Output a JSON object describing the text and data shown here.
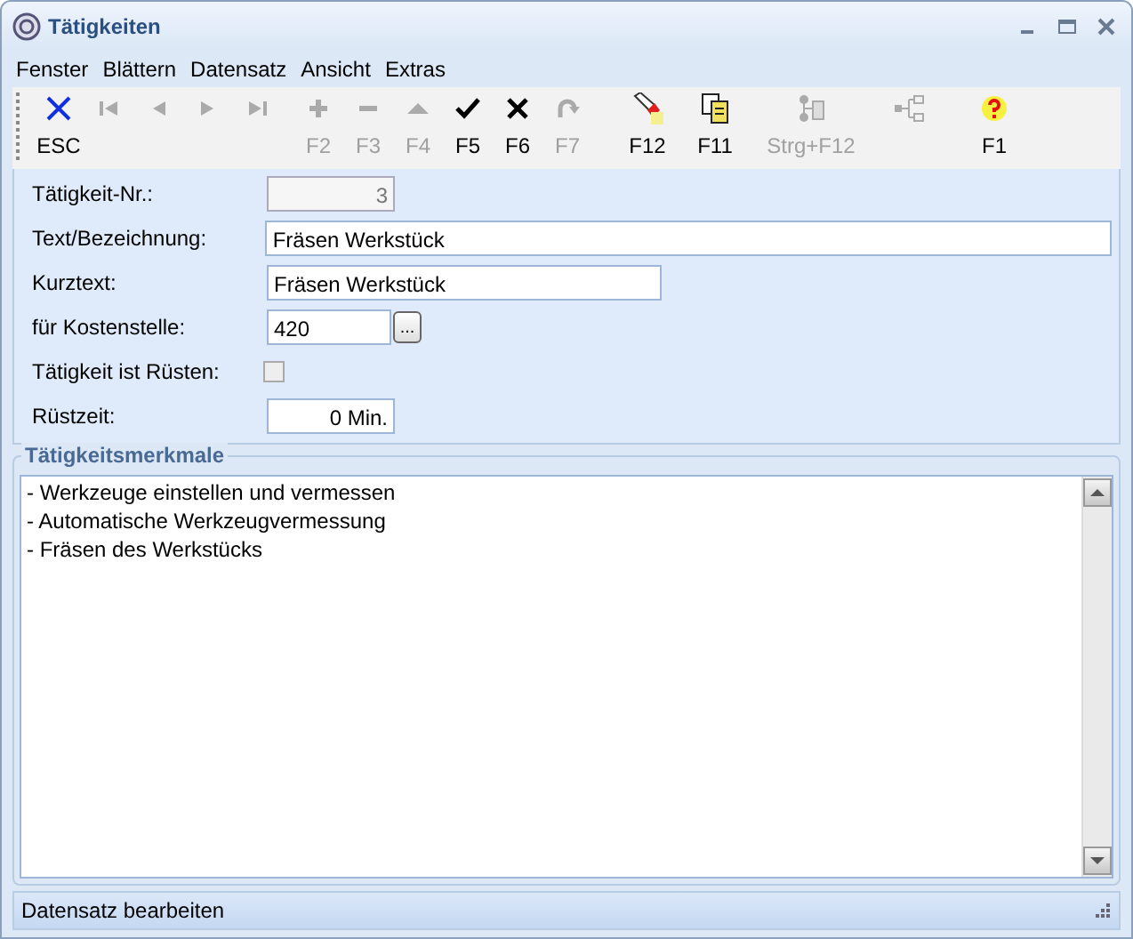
{
  "window": {
    "title": "Tätigkeiten"
  },
  "menu": [
    "Fenster",
    "Blättern",
    "Datensatz",
    "Ansicht",
    "Extras"
  ],
  "toolbar": [
    {
      "kind": "esc",
      "label": "ESC",
      "disabled": false
    },
    {
      "kind": "first",
      "disabled": true
    },
    {
      "kind": "prev",
      "disabled": true
    },
    {
      "kind": "next",
      "disabled": true
    },
    {
      "kind": "last",
      "disabled": true
    },
    {
      "kind": "plus",
      "label": "F2",
      "disabled": true
    },
    {
      "kind": "minus",
      "label": "F3",
      "disabled": true
    },
    {
      "kind": "up",
      "label": "F4",
      "disabled": true
    },
    {
      "kind": "check",
      "label": "F5",
      "disabled": false
    },
    {
      "kind": "cross",
      "label": "F6",
      "disabled": false
    },
    {
      "kind": "redo",
      "label": "F7",
      "disabled": true
    },
    {
      "kind": "torch",
      "label": "F12",
      "disabled": false
    },
    {
      "kind": "copy",
      "label": "F11",
      "disabled": false
    },
    {
      "kind": "tree",
      "label": "Strg+F12",
      "disabled": true
    },
    {
      "kind": "branch",
      "disabled": true
    },
    {
      "kind": "help",
      "label": "F1",
      "disabled": false
    }
  ],
  "form": [
    {
      "kind": "number",
      "label": "Tätigkeit-Nr.:",
      "value": "3",
      "disabled": true
    },
    {
      "kind": "longtext",
      "label": "Text/Bezeichnung:",
      "value": "Fräsen Werkstück"
    },
    {
      "kind": "shorttext",
      "label": "Kurztext:",
      "value": "Fräsen Werkstück"
    },
    {
      "kind": "lookup",
      "label": "für Kostenstelle:",
      "value": "420",
      "button": "..."
    },
    {
      "kind": "checkbox",
      "label": "Tätigkeit ist Rüsten:",
      "checked": false
    },
    {
      "kind": "number",
      "label": "Rüstzeit:",
      "value": "0 Min.",
      "disabled": false
    }
  ],
  "features": {
    "title": "Tätigkeitsmerkmale",
    "lines": [
      "- Werkzeuge einstellen und vermessen",
      "- Automatische Werkzeugvermessung",
      "- Fräsen des Werkstücks"
    ]
  },
  "status_bar": "Datensatz bearbeiten"
}
